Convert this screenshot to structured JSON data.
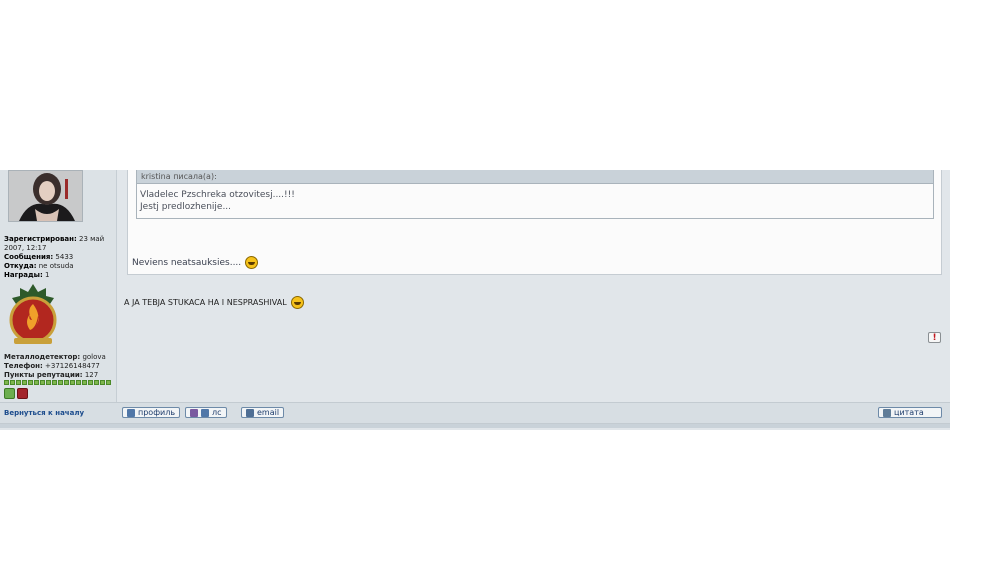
{
  "user": {
    "avatar_name": "user-avatar",
    "registered_label": "Зарегистрирован:",
    "registered_value": "23 май 2007, 12:17",
    "posts_label": "Сообщения:",
    "posts_value": "5433",
    "from_label": "Откуда:",
    "from_value": "ne otsuda",
    "awards_label": "Награды:",
    "awards_value": "1",
    "metal_label": "Металлодетектор:",
    "metal_value": "golova",
    "phone_label": "Телефон:",
    "phone_value": "+37126148477",
    "rep_label": "Пункты репутации:",
    "rep_value": "127"
  },
  "quote": {
    "header": "kristina писала(а):",
    "line1": "Vladelec Pzschreka otzovitesj....!!!",
    "line2": "Jestj predlozhenije..."
  },
  "post": {
    "reply1": "Neviens neatsauksies....",
    "reply2": "A JA TEBJA STUKACA HA I NESPRASHIVAL"
  },
  "bottom": {
    "back_to_top": "Вернуться к началу",
    "profile_btn": "профиль",
    "pm_btn": "лс",
    "email_btn": "email",
    "quote_btn": "цитата"
  },
  "colors": {
    "background": "#e1e6ea",
    "link": "#1b4b8c",
    "rep_green": "#7fb64e"
  }
}
